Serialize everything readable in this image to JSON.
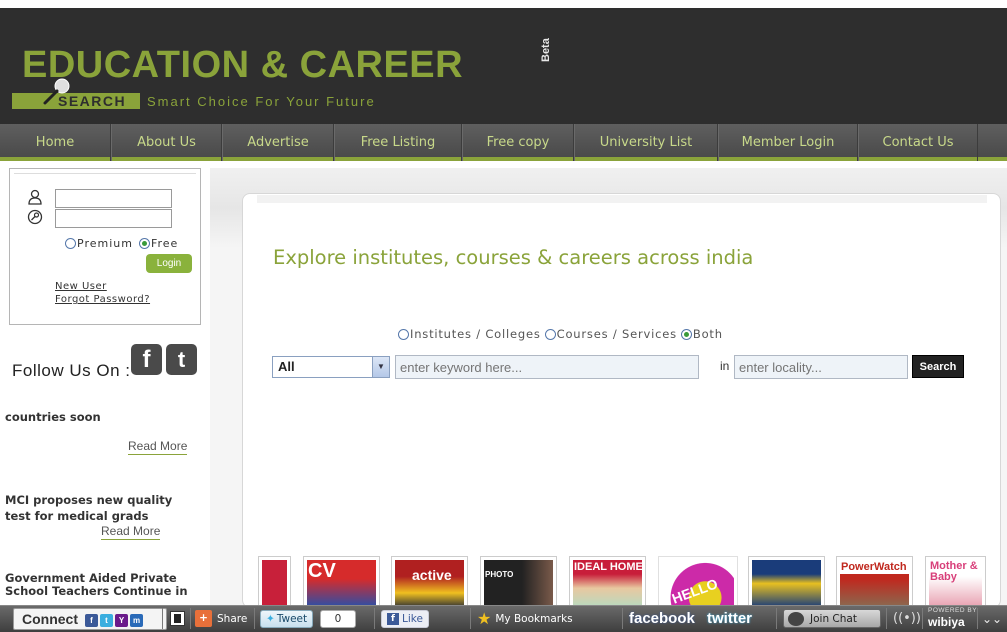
{
  "brand": {
    "title": "EDUCATION & CAREER",
    "beta": "Beta",
    "search": "SEARCH",
    "tagline": "Smart Choice For Your Future",
    "accent_color": "#8aa33a"
  },
  "nav": {
    "items": [
      "Home",
      "About Us",
      "Advertise",
      "Free Listing",
      "Free copy",
      "University List",
      "Member Login",
      "Contact Us"
    ]
  },
  "login": {
    "user_value": "",
    "pass_value": "",
    "radio_premium": "Premium",
    "radio_free": "Free",
    "selected": "Free",
    "button": "Login",
    "new_user": "New User",
    "forgot": "Forgot Password?"
  },
  "follow": {
    "label": "Follow Us On :",
    "icons": [
      "facebook-icon",
      "twitter-icon"
    ]
  },
  "news": [
    {
      "title": "countries soon",
      "read_more": "Read More"
    },
    {
      "title": "MCI proposes new quality test for medical grads",
      "read_more": "Read More"
    },
    {
      "title": "Government Aided Private School Teachers Continue in",
      "read_more": ""
    }
  ],
  "search": {
    "headline": "Explore institutes, courses & careers across india",
    "type_options": [
      "Institutes / Colleges",
      "Courses / Services",
      "Both"
    ],
    "type_selected": "Both",
    "category_value": "All",
    "keyword_placeholder": "enter keyword here...",
    "in_label": "in",
    "locality_placeholder": "enter locality...",
    "button": "Search"
  },
  "magazines": [
    {
      "title": "",
      "color": "#c8203a"
    },
    {
      "title": "CV",
      "color": "#d62b2b"
    },
    {
      "title": "active",
      "color": "#b02020"
    },
    {
      "title": "PHOTO",
      "color": "#333333"
    },
    {
      "title": "IDEAL HOME",
      "color": "#c81e3a"
    },
    {
      "title": "HELLO",
      "color": "#cc2aa8"
    },
    {
      "title": "",
      "color": "#1a3c7a"
    },
    {
      "title": "PowerWatch",
      "color": "#c0281e"
    },
    {
      "title": "Mother & Baby",
      "color": "#d8407a"
    }
  ],
  "toolbar": {
    "connect": "Connect",
    "share": "Share",
    "tweet": "Tweet",
    "tweet_count": "0",
    "like": "Like",
    "bookmarks": "My Bookmarks",
    "facebook": "facebook",
    "twitter": "twitter",
    "join_chat": "Join Chat",
    "powered_by": "POWERED BY",
    "wibiya": "wibiya"
  }
}
